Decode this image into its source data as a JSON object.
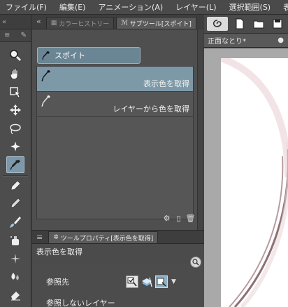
{
  "menu": [
    "ファイル(F)",
    "編集(E)",
    "アニメーション(A)",
    "レイヤー(L)",
    "選択範囲(S)",
    "表示"
  ],
  "tool_column": {
    "tools": [
      {
        "name": "zoom-tool-icon",
        "active": false
      },
      {
        "name": "hand-tool-icon",
        "active": false
      },
      {
        "name": "operation-tool-icon",
        "active": false
      },
      {
        "name": "move-layer-tool-icon",
        "active": false
      },
      {
        "name": "lasso-selection-tool-icon",
        "active": false
      },
      {
        "name": "auto-select-wand-icon",
        "active": false
      },
      {
        "name": "eyedropper-tool-icon",
        "active": true
      },
      {
        "name": "pen-tool-icon",
        "active": false
      },
      {
        "name": "pencil-tool-icon",
        "active": false
      },
      {
        "name": "brush-tool-icon",
        "active": false
      },
      {
        "name": "airbrush-tool-icon",
        "active": false
      },
      {
        "name": "decoration-tool-icon",
        "active": false
      },
      {
        "name": "blend-tool-icon",
        "active": false
      },
      {
        "name": "eraser-tool-icon",
        "active": false
      }
    ]
  },
  "subtool_panel": {
    "tabs": [
      {
        "label": "カラーヒストリー",
        "active": false
      },
      {
        "label": "サブツール[スポイト]",
        "active": true
      }
    ],
    "group_label": "スポイト",
    "items": [
      {
        "label": "表示色を取得",
        "selected": true
      },
      {
        "label": "レイヤーから色を取得",
        "selected": false
      }
    ]
  },
  "tool_property": {
    "tab_label": "ツールプロパティ[表示色を取得]",
    "title": "表示色を取得",
    "rows": [
      {
        "label": "参照先"
      },
      {
        "label": "参照しないレイヤー"
      }
    ]
  },
  "canvas": {
    "tab_title": "正面なとり*"
  },
  "colors": {
    "accent": "#7d99a8",
    "panel": "#4f4f4f",
    "menubar": "#4a4a4a"
  }
}
